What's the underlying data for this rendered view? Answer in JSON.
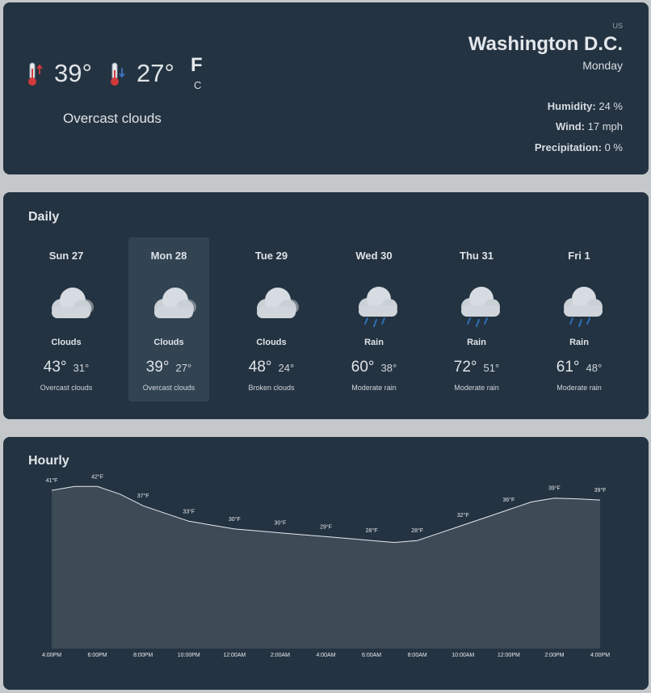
{
  "current": {
    "high": "39°",
    "low": "27°",
    "unit_primary": "F",
    "unit_secondary": "C",
    "description": "Overcast clouds",
    "country": "US",
    "city": "Washington D.C.",
    "day": "Monday",
    "humidity_label": "Humidity:",
    "humidity_value": "24 %",
    "wind_label": "Wind:",
    "wind_value": "17 mph",
    "precip_label": "Precipitation:",
    "precip_value": "0 %",
    "icons": {
      "high": "thermometer-up-icon",
      "low": "thermometer-down-icon"
    },
    "colors": {
      "arrow_up": "#d23a3a",
      "arrow_down": "#3b74c4",
      "bulb": "#d23a3a"
    }
  },
  "daily": {
    "title": "Daily",
    "selected_index": 1,
    "days": [
      {
        "name": "Sun 27",
        "main": "Clouds",
        "high": "43°",
        "low": "31°",
        "desc": "Overcast clouds",
        "icon": "clouds-icon"
      },
      {
        "name": "Mon 28",
        "main": "Clouds",
        "high": "39°",
        "low": "27°",
        "desc": "Overcast clouds",
        "icon": "clouds-icon"
      },
      {
        "name": "Tue 29",
        "main": "Clouds",
        "high": "48°",
        "low": "24°",
        "desc": "Broken clouds",
        "icon": "clouds-icon"
      },
      {
        "name": "Wed 30",
        "main": "Rain",
        "high": "60°",
        "low": "38°",
        "desc": "Moderate rain",
        "icon": "rain-icon"
      },
      {
        "name": "Thu 31",
        "main": "Rain",
        "high": "72°",
        "low": "51°",
        "desc": "Moderate rain",
        "icon": "rain-icon"
      },
      {
        "name": "Fri 1",
        "main": "Rain",
        "high": "61°",
        "low": "48°",
        "desc": "Moderate rain",
        "icon": "rain-icon"
      }
    ]
  },
  "hourly": {
    "title": "Hourly",
    "chart_data": {
      "type": "area",
      "x": [
        "4:00PM",
        "5:00PM",
        "6:00PM",
        "7:00PM",
        "8:00PM",
        "9:00PM",
        "10:00PM",
        "11:00PM",
        "12:00AM",
        "1:00AM",
        "2:00AM",
        "3:00AM",
        "4:00AM",
        "5:00AM",
        "6:00AM",
        "7:00AM",
        "8:00AM",
        "9:00AM",
        "10:00AM",
        "11:00AM",
        "12:00PM",
        "1:00PM",
        "2:00PM",
        "3:00PM",
        "4:00PM"
      ],
      "series": [
        {
          "values": [
            41,
            42,
            42,
            40,
            37,
            35,
            33,
            32,
            31,
            30.5,
            30,
            29.5,
            29,
            28.5,
            28,
            27.5,
            28,
            30,
            32,
            34,
            36,
            38,
            39,
            38.8,
            38.5
          ]
        }
      ],
      "x_tick_labels": [
        "4:00PM",
        "6:00PM",
        "8:00PM",
        "10:00PM",
        "12:00AM",
        "2:00AM",
        "4:00AM",
        "6:00AM",
        "8:00AM",
        "10:00AM",
        "12:00PM",
        "2:00PM",
        "4:00PM"
      ],
      "point_labels": [
        {
          "x": "4:00PM",
          "y": 41,
          "text": "41°F"
        },
        {
          "x": "6:00PM",
          "y": 42,
          "text": "42°F"
        },
        {
          "x": "8:00PM",
          "y": 37,
          "text": "37°F"
        },
        {
          "x": "10:00PM",
          "y": 33,
          "text": "33°F"
        },
        {
          "x": "12:00AM",
          "y": 31,
          "text": "30°F"
        },
        {
          "x": "2:00AM",
          "y": 30,
          "text": "30°F"
        },
        {
          "x": "4:00AM",
          "y": 29,
          "text": "29°F"
        },
        {
          "x": "6:00AM",
          "y": 28,
          "text": "28°F"
        },
        {
          "x": "8:00AM",
          "y": 28,
          "text": "28°F"
        },
        {
          "x": "10:00AM",
          "y": 32,
          "text": "32°F"
        },
        {
          "x": "12:00PM",
          "y": 36,
          "text": "36°F"
        },
        {
          "x": "2:00PM",
          "y": 39,
          "text": "39°F"
        },
        {
          "x": "4:00PM",
          "y": 38.5,
          "text": "39°F"
        }
      ],
      "ylim": [
        0,
        45
      ],
      "grid": false,
      "colors": {
        "fill": "#3d4b57",
        "line": "#e6eaee"
      }
    }
  }
}
